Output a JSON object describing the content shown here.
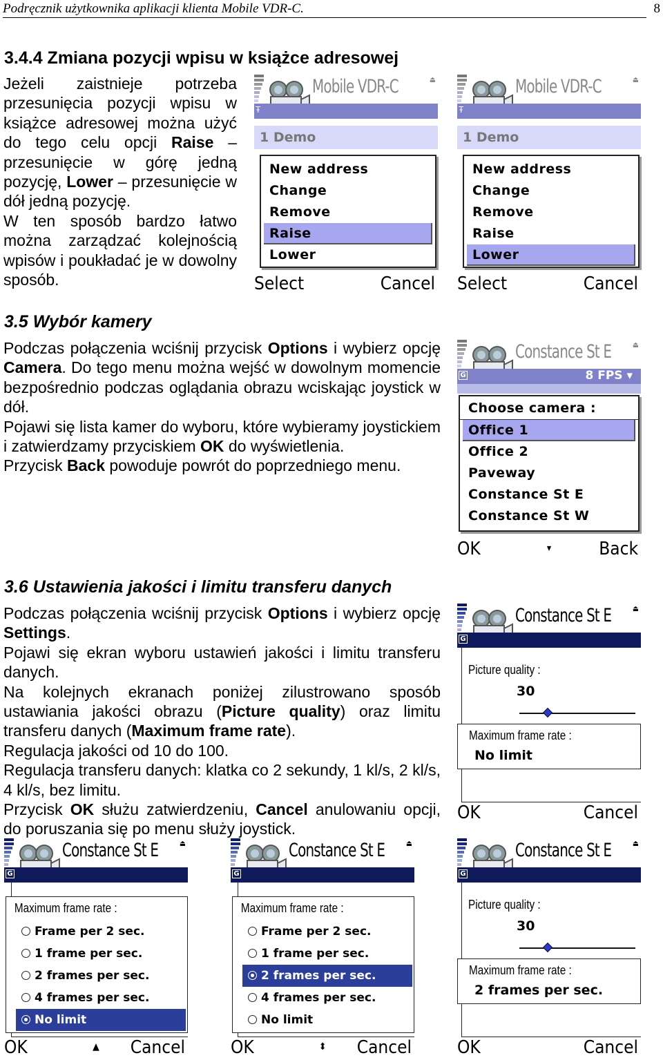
{
  "header": {
    "title": "Podręcznik użytkownika aplikacji klienta Mobile VDR-C.",
    "page_number": "8"
  },
  "section_344": {
    "heading": "3.4.4  Zmiana pozycji wpisu w książce adresowej",
    "p1_a": "Jeżeli zaistnieje potrzeba przesunięcia pozycji wpisu w książce adresowej można użyć do tego celu opcji ",
    "p1_b": "Raise",
    "p1_c": " – przesunięcie w górę jedną pozycję, ",
    "p1_d": "Lower",
    "p1_e": " – przesunięcie w dół jedną pozycję.",
    "p2": "W ten sposób bardzo łatwo można zarządzać kolejnością wpisów i poukładać je w dowolny sposób."
  },
  "section_35": {
    "heading": "3.5  Wybór kamery",
    "p1_a": "Podczas połączenia wciśnij przycisk ",
    "p1_b": "Options",
    "p1_c": " i wybierz opcję ",
    "p1_d": "Camera",
    "p1_e": ". Do tego menu można wejść w dowolnym momencie bezpośrednio podczas oglądania obrazu wciskając joystick w dół.",
    "p2_a": "Pojawi się lista kamer do wyboru, które wybieramy joystickiem i zatwierdzamy przyciskiem ",
    "p2_b": "OK",
    "p2_c": " do wyświetlenia.",
    "p3_a": "Przycisk ",
    "p3_b": "Back",
    "p3_c": " powoduje powrót do poprzedniego menu."
  },
  "section_36": {
    "heading": "3.6  Ustawienia jakości i limitu transferu danych",
    "p1_a": "Podczas połączenia wciśnij przycisk ",
    "p1_b": "Options",
    "p1_c": " i wybierz opcję ",
    "p1_d": "Settings",
    "p1_e": ".",
    "p2": "Pojawi się ekran wyboru ustawień jakości i limitu transferu danych.",
    "p3_a": "Na kolejnych ekranach poniżej zilustrowano sposób ustawiania jakości obrazu (",
    "p3_b": "Picture quality",
    "p3_c": ") oraz limitu transferu danych (",
    "p3_d": "Maximum frame rate",
    "p3_e": ").",
    "p4": "Regulacja jakości od 10 do 100.",
    "p5": "Regulacja transferu danych: klatka co 2 sekundy, 1 kl/s, 2 kl/s, 4 kl/s, bez limitu.",
    "p6_a": "Przycisk ",
    "p6_b": "OK",
    "p6_c": " służu zatwierdzeniu, ",
    "p6_d": "Cancel",
    "p6_e": " anulowaniu opcji, do poruszania się po menu służy joystick."
  },
  "screens": {
    "raise": {
      "app_title": "Mobile VDR-C",
      "list_item": "1  Demo",
      "menu": [
        "New address",
        "Change",
        "Remove",
        "Raise",
        "Lower"
      ],
      "selected_index": 3,
      "left_softkey": "Select",
      "right_softkey": "Cancel"
    },
    "lower": {
      "app_title": "Mobile VDR-C",
      "list_item": "1  Demo",
      "menu": [
        "New address",
        "Change",
        "Remove",
        "Raise",
        "Lower"
      ],
      "selected_index": 4,
      "left_softkey": "Select",
      "right_softkey": "Cancel"
    },
    "camera": {
      "app_title": "Constance St E",
      "fps": "8 FPS",
      "menu_title": "Choose camera :",
      "menu": [
        "Office 1",
        "Office 2",
        "Paveway",
        "Constance St E",
        "Constance St W"
      ],
      "selected_index": 0,
      "left_softkey": "OK",
      "right_softkey": "Back"
    },
    "settings_nolimit": {
      "app_title": "Constance St E",
      "quality_label": "Picture quality :",
      "quality_value": "30",
      "quality_slider": {
        "min": 10,
        "max": 100,
        "value": 30
      },
      "rate_label": "Maximum frame rate :",
      "rate_value": "No limit",
      "left_softkey": "OK",
      "right_softkey": "Cancel"
    },
    "rate_nolimit": {
      "app_title": "Constance St E",
      "rate_label": "Maximum frame rate :",
      "options": [
        "Frame per 2 sec.",
        "1 frame per sec.",
        "2 frames per sec.",
        "4 frames per sec.",
        "No limit"
      ],
      "selected_index": 4,
      "left_softkey": "OK",
      "right_softkey": "Cancel"
    },
    "rate_2fps": {
      "app_title": "Constance St E",
      "rate_label": "Maximum frame rate :",
      "options": [
        "Frame per 2 sec.",
        "1 frame per sec.",
        "2 frames per sec.",
        "4 frames per sec.",
        "No limit"
      ],
      "selected_index": 2,
      "left_softkey": "OK",
      "right_softkey": "Cancel"
    },
    "settings_2fps": {
      "app_title": "Constance St E",
      "quality_label": "Picture quality :",
      "quality_value": "30",
      "quality_slider": {
        "min": 10,
        "max": 100,
        "value": 30
      },
      "rate_label": "Maximum frame rate :",
      "rate_value": "2 frames per sec.",
      "left_softkey": "OK",
      "right_softkey": "Cancel"
    }
  },
  "colors": {
    "faded_bar": "#7f82c8",
    "active_bar": "#0f1a5c",
    "menu_highlight": "#a7a7f0",
    "radio_highlight": "#2b3e9a"
  }
}
